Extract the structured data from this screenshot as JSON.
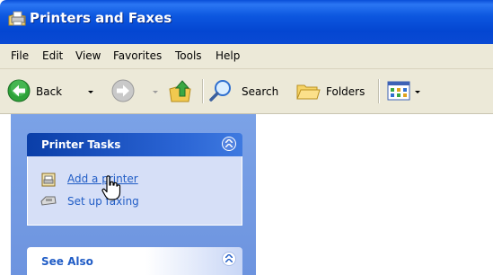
{
  "window": {
    "title": "Printers and Faxes",
    "title_icon": "printer-folder-icon"
  },
  "menu": [
    "File",
    "Edit",
    "View",
    "Favorites",
    "Tools",
    "Help"
  ],
  "toolbar": {
    "back_label": "Back",
    "search_label": "Search",
    "folders_label": "Folders",
    "icons": {
      "back": "back-arrow-icon",
      "forward": "forward-arrow-icon",
      "up": "up-folder-icon",
      "search": "search-icon",
      "folders": "folders-icon",
      "views": "views-icon"
    }
  },
  "task_pane": {
    "printer_tasks": {
      "title": "Printer Tasks",
      "items": [
        {
          "label": "Add a printer",
          "icon": "add-printer-icon",
          "hover": true
        },
        {
          "label": "Set up faxing",
          "icon": "fax-icon"
        }
      ]
    },
    "see_also": {
      "title": "See Also"
    }
  },
  "cursor": "hand-pointer-cursor",
  "colors": {
    "title_bar": "#0a4ad4",
    "task_link": "#215dc6",
    "task_pane_bg": "#7ba2e7",
    "chrome": "#ece9d8"
  }
}
